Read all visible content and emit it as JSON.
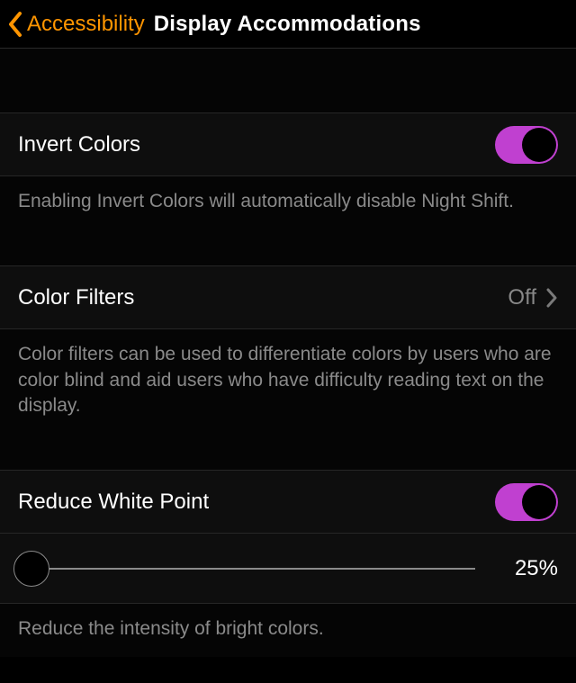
{
  "nav": {
    "back_label": "Accessibility",
    "title": "Display Accommodations"
  },
  "sections": {
    "invert": {
      "label": "Invert Colors",
      "footer": "Enabling Invert Colors will automatically disable Night Shift.",
      "on": true
    },
    "filters": {
      "label": "Color Filters",
      "value": "Off",
      "footer": "Color filters can be used to differentiate colors by users who are color blind and aid users who have difficulty reading text on the display."
    },
    "whitepoint": {
      "label": "Reduce White Point",
      "on": true,
      "percent": "25%",
      "footer": "Reduce the intensity of bright colors."
    }
  },
  "colors": {
    "accent_orange": "#ff9500",
    "accent_toggle": "#c040d0"
  }
}
